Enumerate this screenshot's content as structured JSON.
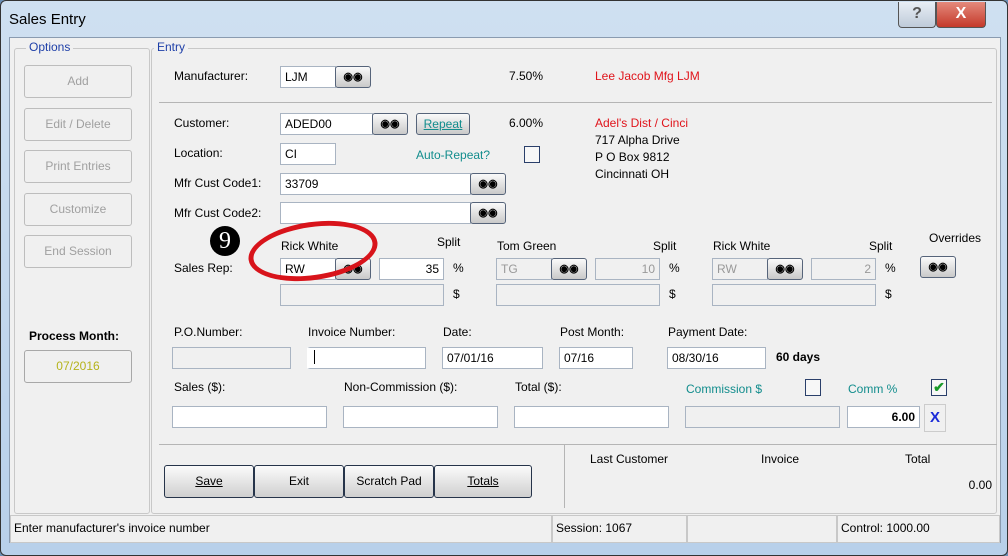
{
  "window": {
    "title": "Sales Entry",
    "help": "?",
    "close": "X"
  },
  "options": {
    "label": "Options",
    "buttons": [
      "Add",
      "Edit / Delete",
      "Print Entries",
      "Customize",
      "End Session"
    ],
    "process_month_label": "Process Month:",
    "process_month": "07/2016"
  },
  "entry": {
    "label": "Entry",
    "manufacturer": {
      "label": "Manufacturer:",
      "value": "LJM",
      "percent": "7.50%",
      "name": "Lee Jacob Mfg  LJM"
    },
    "customer": {
      "label": "Customer:",
      "value": "ADED00",
      "repeat": "Repeat",
      "percent": "6.00%",
      "name": "Adel's Dist / Cinci",
      "address": [
        "717 Alpha Drive",
        "P O Box 9812",
        "Cincinnati OH"
      ]
    },
    "location": {
      "label": "Location:",
      "value": "CI",
      "auto_repeat": "Auto-Repeat?"
    },
    "mfr_cust_code1": {
      "label": "Mfr Cust Code1:",
      "value": "33709"
    },
    "mfr_cust_code2": {
      "label": "Mfr Cust Code2:",
      "value": ""
    },
    "sales_rep": {
      "label": "Sales Rep:",
      "split_label": "Split",
      "pct": "%",
      "dollar": "$",
      "overrides": "Overrides",
      "reps": [
        {
          "name": "Rick White",
          "code": "RW",
          "split": "35"
        },
        {
          "name": "Tom Green",
          "code": "TG",
          "split": "10"
        },
        {
          "name": "Rick White",
          "code": "RW",
          "split": "2"
        }
      ]
    },
    "annotation": "9",
    "po_label": "P.O.Number:",
    "po": "",
    "invoice_label": "Invoice Number:",
    "invoice": "",
    "date_label": "Date:",
    "date": "07/01/16",
    "post_month_label": "Post Month:",
    "post_month": "07/16",
    "payment_date_label": "Payment Date:",
    "payment_date": "08/30/16",
    "days": "60  days",
    "sales_label": "Sales ($):",
    "noncomm_label": "Non-Commission ($):",
    "total_label": "Total ($):",
    "commission_label": "Commission $",
    "comm_pct_label": "Comm %",
    "comm_pct": "6.00",
    "clear": "X",
    "comm_pct_checked": true,
    "commission_checked": false
  },
  "actions": {
    "save": "Save",
    "exit": "Exit",
    "scratch": "Scratch Pad",
    "totals": "Totals"
  },
  "last": {
    "customer": "Last Customer",
    "invoice": "Invoice",
    "total": "Total",
    "total_value": "0.00"
  },
  "status": {
    "message": "Enter manufacturer's invoice number",
    "session": "Session: 1067",
    "blank": "",
    "control": "Control:   1000.00"
  }
}
